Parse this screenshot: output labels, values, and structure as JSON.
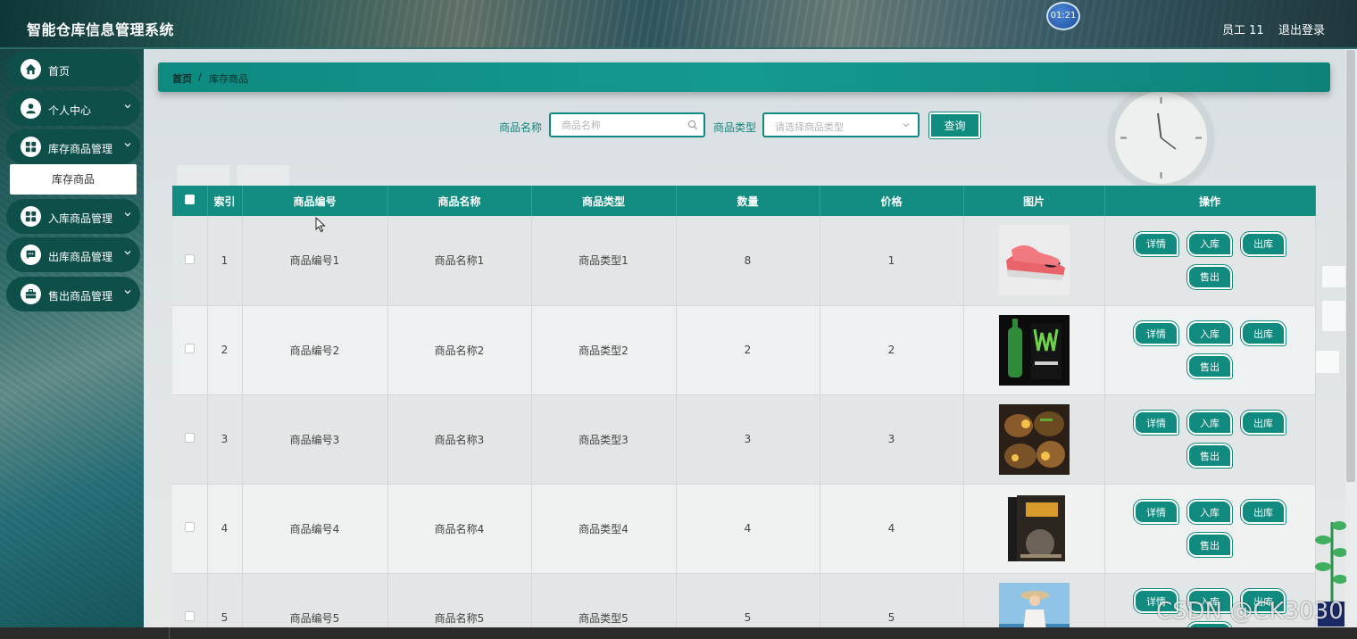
{
  "header": {
    "title": "智能仓库信息管理系统",
    "clock_badge": "01:21",
    "user_name": "员工 11",
    "logout_label": "退出登录"
  },
  "sidebar": {
    "items": [
      {
        "label": "首页",
        "icon": "home-icon"
      },
      {
        "label": "个人中心",
        "icon": "user-icon"
      },
      {
        "label": "库存商品管理",
        "icon": "grid-icon"
      },
      {
        "label": "入库商品管理",
        "icon": "grid-icon"
      },
      {
        "label": "出库商品管理",
        "icon": "chat-icon"
      },
      {
        "label": "售出商品管理",
        "icon": "briefcase-icon"
      }
    ],
    "submenu_active": "库存商品"
  },
  "breadcrumb": {
    "home": "首页",
    "separator": "/",
    "current": "库存商品"
  },
  "search": {
    "name_label": "商品名称",
    "name_placeholder": "商品名称",
    "type_label": "商品类型",
    "type_placeholder": "请选择商品类型",
    "query_label": "查询"
  },
  "table": {
    "headers": [
      "索引",
      "商品编号",
      "商品名称",
      "商品类型",
      "数量",
      "价格",
      "图片",
      "操作"
    ],
    "rows": [
      {
        "index": "1",
        "code": "商品编号1",
        "name": "商品名称1",
        "type": "商品类型1",
        "qty": "8",
        "price": "1",
        "image": "shoe-image"
      },
      {
        "index": "2",
        "code": "商品编号2",
        "name": "商品名称2",
        "type": "商品类型2",
        "qty": "2",
        "price": "2",
        "image": "drink-image"
      },
      {
        "index": "3",
        "code": "商品编号3",
        "name": "商品名称3",
        "type": "商品类型3",
        "qty": "3",
        "price": "3",
        "image": "food-image"
      },
      {
        "index": "4",
        "code": "商品编号4",
        "name": "商品名称4",
        "type": "商品类型4",
        "qty": "4",
        "price": "4",
        "image": "book-image"
      },
      {
        "index": "5",
        "code": "商品编号5",
        "name": "商品名称5",
        "type": "商品类型5",
        "qty": "5",
        "price": "5",
        "image": "person-image"
      }
    ],
    "actions": {
      "detail": "详情",
      "inbound": "入库",
      "outbound": "出库",
      "sold": "售出"
    }
  },
  "watermark": "CSDN @CK3030",
  "colors": {
    "accent": "#138d82",
    "menu_bg": "#0e4f49",
    "label_teal": "#11857a"
  }
}
